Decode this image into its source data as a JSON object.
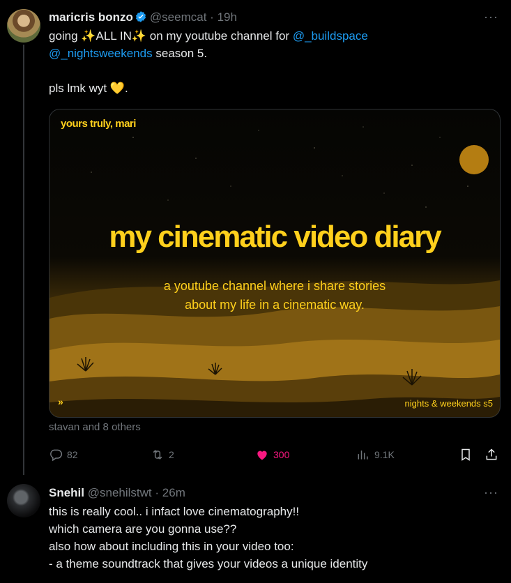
{
  "tweet": {
    "author_name": "maricris bonzo",
    "handle": "@seemcat",
    "separator": "·",
    "time": "19h",
    "more": "···",
    "line1_a": "going ",
    "sparkle1": "✨",
    "all_in": "ALL IN",
    "sparkle2": "✨",
    "line1_b": " on my youtube channel for ",
    "mention1": "@_buildspace",
    "mention2": "@_nightsweekends",
    "line2_b": " season 5.",
    "line3_a": "pls lmk wyt ",
    "heart_emoji": "💛",
    "line3_b": ".",
    "media": {
      "corner": "yours truly, mari",
      "title": "my cinematic video diary",
      "subtitle_1": "a youtube channel where i share stories",
      "subtitle_2": "about my life in a cinematic way.",
      "brand": "nights & weekends s5",
      "logo": "»"
    },
    "likers": "stavan and 8 others",
    "actions": {
      "replies": "82",
      "retweets": "2",
      "likes": "300",
      "views": "9.1K"
    }
  },
  "reply": {
    "author_name": "Snehil",
    "handle": "@snehilstwt",
    "separator": "·",
    "time": "26m",
    "more": "···",
    "lines": [
      "this is really cool.. i infact love cinematography!!",
      "which camera are you gonna use??",
      "also how about including this in your video too:",
      "- a theme soundtrack that gives your videos a unique identity"
    ]
  },
  "colors": {
    "accent": "#1d9bf0",
    "like": "#f91880",
    "muted": "#71767b",
    "media_yellow": "#ffd01c"
  }
}
